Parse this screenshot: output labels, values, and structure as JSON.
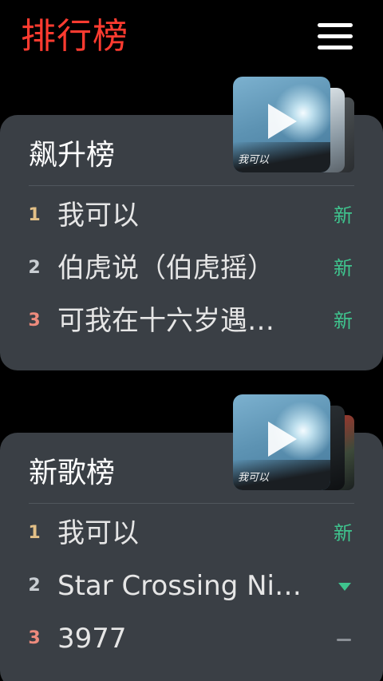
{
  "header": {
    "title": "排行榜"
  },
  "charts": [
    {
      "title": "飙升榜",
      "cover_text": "我可以",
      "songs": [
        {
          "rank": "1",
          "name": "我可以",
          "trend": "新"
        },
        {
          "rank": "2",
          "name": "伯虎说（伯虎摇）",
          "trend": "新"
        },
        {
          "rank": "3",
          "name": "可我在十六岁遇…",
          "trend": "新"
        }
      ]
    },
    {
      "title": "新歌榜",
      "cover_text": "我可以",
      "songs": [
        {
          "rank": "1",
          "name": "我可以",
          "trend": "新"
        },
        {
          "rank": "2",
          "name": "Star Crossing Ni…",
          "trend_icon": "down-triangle-icon"
        },
        {
          "rank": "3",
          "name": "3977",
          "trend_icon": "flat-dash-icon"
        }
      ]
    }
  ],
  "colors": {
    "title": "#ff3b30",
    "card_bg": "#3a3f45",
    "new_badge": "#3fc48e",
    "rank_1": "#e3c087",
    "rank_2": "#c9ced3",
    "rank_3": "#ee8b7d"
  },
  "icons": {
    "menu": "hamburger-menu-icon",
    "play": "play-icon"
  }
}
